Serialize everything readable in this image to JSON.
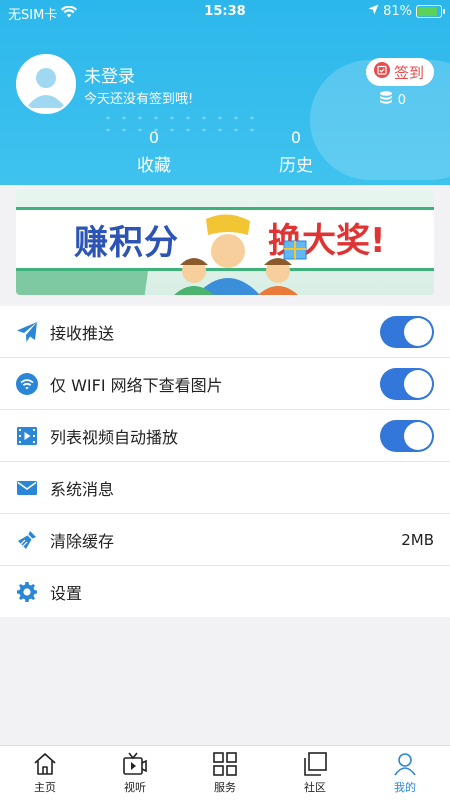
{
  "status_bar": {
    "carrier": "无SIM卡",
    "time": "15:38",
    "battery": "81%"
  },
  "profile": {
    "name": "未登录",
    "subtitle": "今天还没有签到哦!",
    "signin_label": "签到",
    "coins": "0"
  },
  "stats": [
    {
      "count": "0",
      "label": "收藏"
    },
    {
      "count": "0",
      "label": "历史"
    }
  ],
  "banner": {
    "text_left": "赚积分",
    "text_right": "换大奖!"
  },
  "menu": [
    {
      "label": "接收推送",
      "toggle": true
    },
    {
      "label": "仅 WIFI 网络下查看图片",
      "toggle": true
    },
    {
      "label": "列表视频自动播放",
      "toggle": true
    },
    {
      "label": "系统消息"
    },
    {
      "label": "清除缓存",
      "value": "2MB"
    },
    {
      "label": "设置"
    }
  ],
  "tabbar": [
    {
      "label": "主页",
      "icon": "home-icon"
    },
    {
      "label": "视听",
      "icon": "tv-icon"
    },
    {
      "label": "服务",
      "icon": "grid-icon"
    },
    {
      "label": "社区",
      "icon": "squares-icon"
    },
    {
      "label": "我的",
      "icon": "person-icon",
      "active": true
    }
  ],
  "colors": {
    "header": "#2cb7ec",
    "accent": "#3277d9",
    "active_tab": "#2a86d6",
    "signin": "#e94c4c"
  }
}
